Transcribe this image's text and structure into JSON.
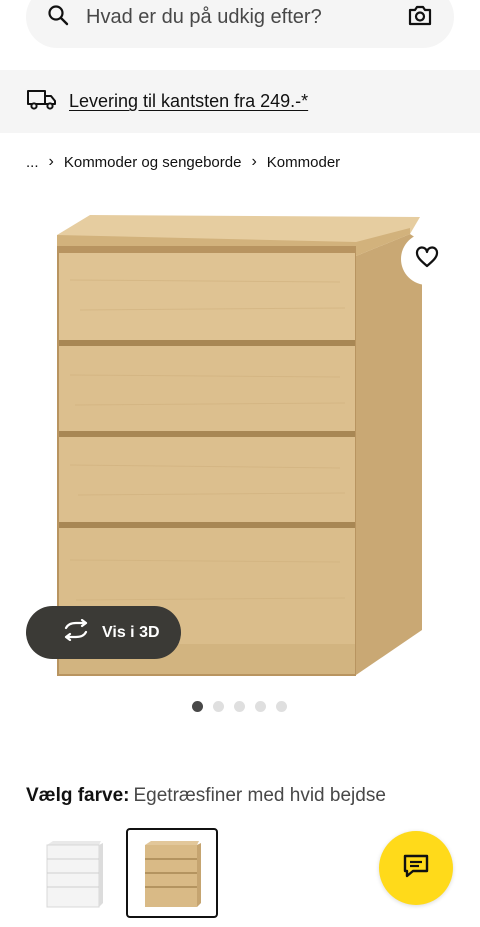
{
  "search": {
    "placeholder": "Hvad er du på udkig efter?",
    "icon": "search-icon",
    "camera_icon": "camera-icon"
  },
  "delivery": {
    "text": "Levering til kantsten fra 249.-*",
    "icon": "truck-icon"
  },
  "breadcrumb": {
    "ellipsis": "...",
    "items": [
      "Kommoder og sengeborde",
      "Kommoder"
    ]
  },
  "gallery": {
    "view_3d_label": "Vis i 3D",
    "current_index": 1,
    "count": 5
  },
  "color_selector": {
    "label": "Vælg farve:",
    "value": "Egetræsfiner med hvid bejdse"
  },
  "colors": {
    "accent": "#ffda1a",
    "wood": "#dcc08e",
    "pill": "#3b3a36"
  }
}
